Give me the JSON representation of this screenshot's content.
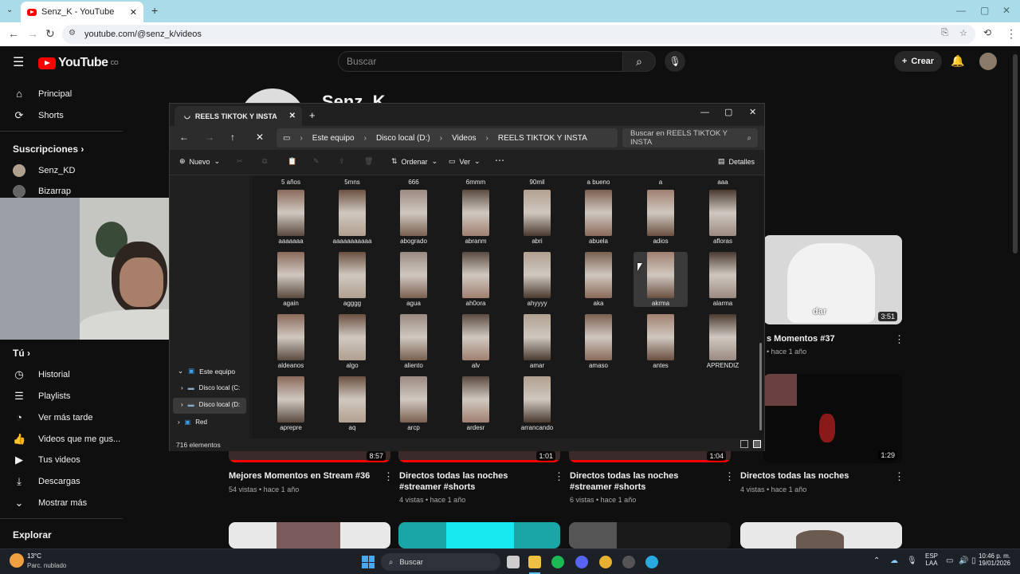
{
  "browser": {
    "tab_title": "Senz_K - YouTube",
    "url": "youtube.com/@senz_k/videos"
  },
  "youtube": {
    "logo_text": "YouTube",
    "logo_country": "CO",
    "search_placeholder": "Buscar",
    "create_label": "Crear",
    "channel_name": "Senz_K",
    "sidebar": {
      "principal": "Principal",
      "shorts": "Shorts",
      "subscriptions_header": "Suscripciones",
      "subs": [
        "Senz_KD",
        "Bizarrap"
      ],
      "tu_header": "Tú",
      "items": [
        "Historial",
        "Playlists",
        "Ver más tarde",
        "Videos que me gus...",
        "Tus videos",
        "Descargas",
        "Mostrar más"
      ],
      "explorar": "Explorar"
    },
    "videos": [
      {
        "title": "Mejores Momentos en Stream #36",
        "meta": "54 vistas • hace 1 año",
        "duration": "8:57"
      },
      {
        "title": "Directos todas las noches #streamer #shorts",
        "meta": "4 vistas • hace 1 año",
        "duration": "1:01"
      },
      {
        "title": "Directos todas las noches #streamer #shorts",
        "meta": "6 vistas • hace 1 año",
        "duration": "1:04"
      },
      {
        "title": "Directos todas las noches",
        "meta": "4 vistas • hace 1 año",
        "duration": "1:29"
      }
    ],
    "top_right_video": {
      "title": "s Momentos #37",
      "meta": "• hace 1 año",
      "duration": "3:51",
      "caption": "dar"
    }
  },
  "explorer": {
    "tab_title": "REELS TIKTOK Y INSTA",
    "breadcrumb": [
      "Este equipo",
      "Disco local (D:)",
      "Videos",
      "REELS TIKTOK Y INSTA"
    ],
    "search_placeholder": "Buscar en REELS TIKTOK Y INSTA",
    "toolbar": {
      "new": "Nuevo",
      "sort": "Ordenar",
      "view": "Ver",
      "details": "Detalles"
    },
    "nav_pane": [
      "Este equipo",
      "Disco local (C:",
      "Disco local (D:",
      "Red"
    ],
    "top_row": [
      "5 años",
      "5mns",
      "666",
      "6mmm",
      "90mil",
      "a bueno",
      "a",
      "aaa"
    ],
    "rows": [
      [
        "aaaaaaa",
        "aaaaaaaaaaa",
        "abogrado",
        "abranm",
        "abri",
        "abuela",
        "adios",
        "afloras"
      ],
      [
        "again",
        "agggg",
        "agua",
        "ah0ora",
        "ahyyyy",
        "aka",
        "akrma",
        "alarma"
      ],
      [
        "aldeanos",
        "algo",
        "aliento",
        "alv",
        "amar",
        "amaso",
        "antes",
        "APRENDIZ"
      ],
      [
        "aprepre",
        "aq",
        "arcp",
        "ardesr",
        "arrancando"
      ]
    ],
    "status": "716 elementos"
  },
  "taskbar": {
    "weather_temp": "13°C",
    "weather_desc": "Parc. nublado",
    "search": "Buscar",
    "lang1": "ESP",
    "lang2": "LAA",
    "time": "10:46 p. m.",
    "date": "19/01/2026"
  }
}
